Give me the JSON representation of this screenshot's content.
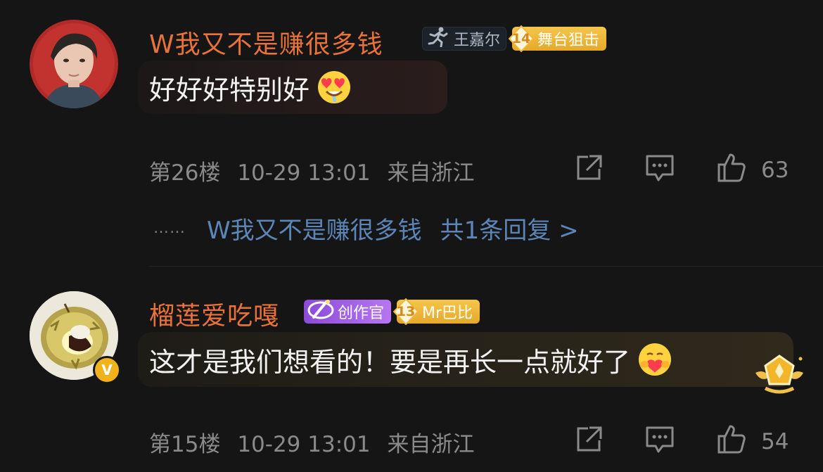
{
  "comments": [
    {
      "username": "W我又不是赚很多钱",
      "idol_badge": "王嘉尔",
      "fan_badge": {
        "level": "14",
        "label": "舞台狙击"
      },
      "text": "好好好特别好",
      "floor": "第26楼",
      "time": "10-29 13:01",
      "location": "来自浙江",
      "likes": "63",
      "reply_preview": {
        "dots": "……",
        "user": "W我又不是赚很多钱",
        "count": "共1条回复 >"
      }
    },
    {
      "username": "榴莲爱吃嘎",
      "creator_badge": "创作官",
      "fan_badge": {
        "level": "13",
        "label": "Mr巴比"
      },
      "verified": "V",
      "text": "这才是我们想看的！要是再长一点就好了",
      "floor": "第15楼",
      "time": "10-29 13:01",
      "location": "来自浙江",
      "likes": "54"
    }
  ],
  "colors": {
    "username": "#e8723a",
    "reply_link": "#5c86b8",
    "meta": "#8a8a8a",
    "background": "#151515"
  },
  "icons": [
    "share-icon",
    "comment-icon",
    "like-icon",
    "running-man-icon",
    "emoji-heart-eyes",
    "emoji-hug",
    "medal-badge-icon"
  ]
}
